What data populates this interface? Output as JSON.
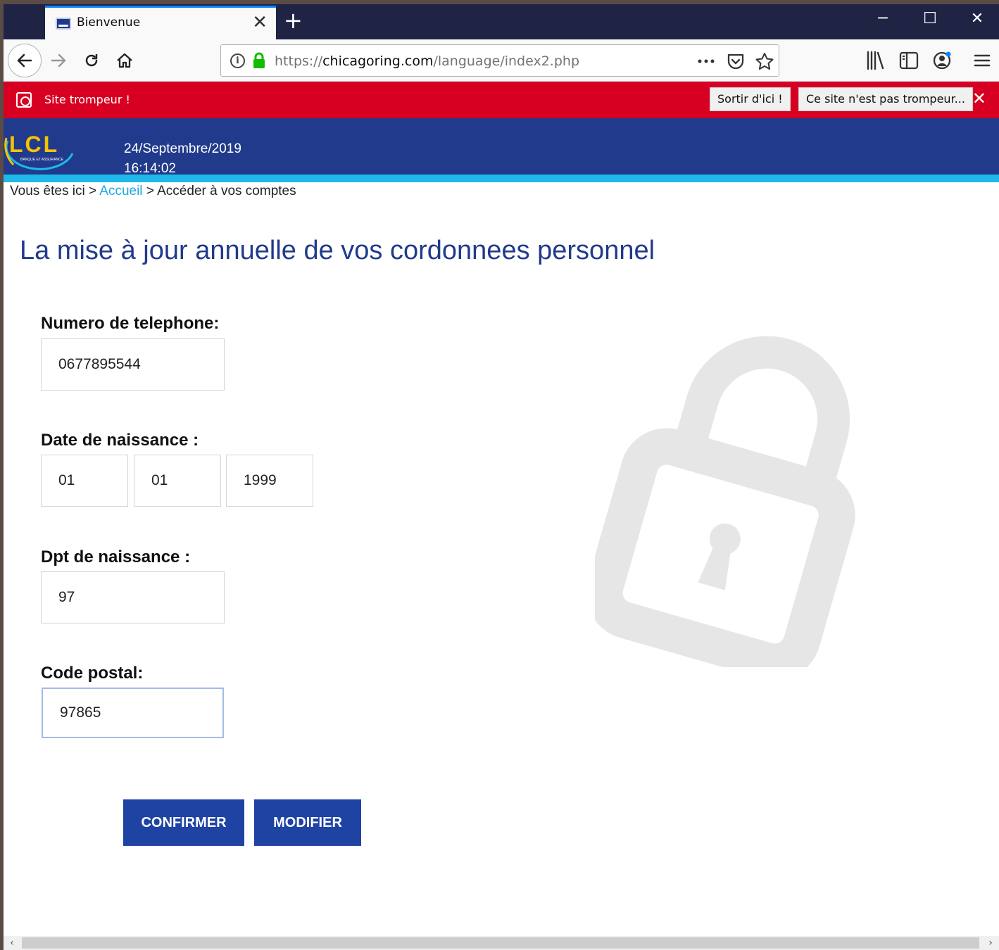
{
  "browser": {
    "tab_title": "Bienvenue",
    "url_prefix": "https://",
    "url_host": "chicagoring.com",
    "url_path": "/language/index2.php"
  },
  "warning": {
    "text": "Site trompeur !",
    "leave_button": "Sortir d'ici !",
    "not_deceptive_button": "Ce site n'est pas trompeur..."
  },
  "header": {
    "date": "24/Septembre/2019",
    "time": "16:14:02"
  },
  "breadcrumb": {
    "prefix": "Vous êtes ici >",
    "home": "Accueil",
    "current": "> Accéder à vos comptes"
  },
  "form": {
    "title": "La mise à jour annuelle de vos cordonnees personnel",
    "phone_label": "Numero de telephone:",
    "phone_value": "0677895544",
    "dob_label": "Date de naissance :",
    "dob_day": "01",
    "dob_month": "01",
    "dob_year": "1999",
    "dpt_label": "Dpt de naissance :",
    "dpt_value": "97",
    "postal_label": "Code postal:",
    "postal_value": "97865",
    "confirm_button": "CONFIRMER",
    "modify_button": "MODIFIER"
  },
  "colors": {
    "brand_blue": "#213a8c",
    "accent_cyan": "#1fb8ea",
    "warning_red": "#d70022",
    "button_blue": "#1e43a3"
  }
}
